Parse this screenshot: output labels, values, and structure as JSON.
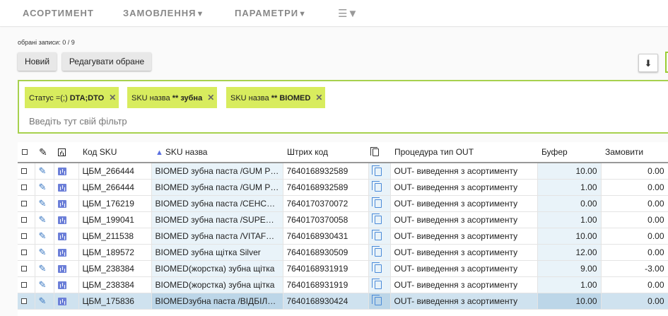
{
  "nav": {
    "items": [
      {
        "label": "АСОРТИМЕНТ",
        "caret": ""
      },
      {
        "label": "ЗАМОВЛЕННЯ",
        "caret": "▼"
      },
      {
        "label": "ПАРАМЕТРИ",
        "caret": "▼"
      }
    ],
    "menu_icon": "☰▼"
  },
  "toolbar": {
    "selected_count": "обрані записи: 0 / 9",
    "new_label": "Новий",
    "edit_label": "Редагувати обране",
    "download_icon": "download-icon"
  },
  "filters": {
    "chips": [
      {
        "field": "Статус",
        "op": "=(;)",
        "value": "DTA;DTO"
      },
      {
        "field": "SKU назва",
        "op": "**",
        "value": "зубна"
      },
      {
        "field": "SKU назва",
        "op": "**",
        "value": "BIOMED"
      }
    ],
    "placeholder": "Введіть тут свій фільтр",
    "accent_color": "#a7d14e",
    "chip_color": "#d8ec5e"
  },
  "table": {
    "headers": {
      "sku_code": "Код SKU",
      "sku_name": "SKU назва",
      "barcode": "Штрих код",
      "procedure": "Процедура тип OUT",
      "buffer": "Буфер",
      "order": "Замовити"
    },
    "sort_indicator": "▲",
    "rows": [
      {
        "code": "ЦБМ_266444",
        "name": "BIOMED зубна паста /GUM PROTECTION",
        "barcode": "7640168932589",
        "procedure": "OUT- виведення з асортименту",
        "buffer": "10.00",
        "order": "0.00"
      },
      {
        "code": "ЦБМ_266444",
        "name": "BIOMED зубна паста /GUM PROTECTION",
        "barcode": "7640168932589",
        "procedure": "OUT- виведення з асортименту",
        "buffer": "1.00",
        "order": "0.00"
      },
      {
        "code": "ЦБМ_176219",
        "name": "BIOMED зубна паста /СЕНСИТИВ",
        "barcode": "7640170370072",
        "procedure": "OUT- виведення з асортименту",
        "buffer": "0.00",
        "order": "0.00"
      },
      {
        "code": "ЦБМ_199041",
        "name": "BIOMED зубна паста /SUPERWHITE",
        "barcode": "7640170370058",
        "procedure": "OUT- виведення з асортименту",
        "buffer": "1.00",
        "order": "0.00"
      },
      {
        "code": "ЦБМ_211538",
        "name": "BIOMED зубна паста /VITAFRESH",
        "barcode": "7640168930431",
        "procedure": "OUT- виведення з асортименту",
        "buffer": "10.00",
        "order": "0.00"
      },
      {
        "code": "ЦБМ_189572",
        "name": "BIOMED зубна щітка Silver",
        "barcode": "7640168930509",
        "procedure": "OUT- виведення з асортименту",
        "buffer": "12.00",
        "order": "0.00"
      },
      {
        "code": "ЦБМ_238384",
        "name": "BIOMED(жорстка) зубна щітка",
        "barcode": "7640168931919",
        "procedure": "OUT- виведення з асортименту",
        "buffer": "9.00",
        "order": "-3.00"
      },
      {
        "code": "ЦБМ_238384",
        "name": "BIOMED(жорстка) зубна щітка",
        "barcode": "7640168931919",
        "procedure": "OUT- виведення з асортименту",
        "buffer": "1.00",
        "order": "0.00"
      },
      {
        "code": "ЦБМ_175836",
        "name": "BIOMEDзубна паста /ВІДБІЛЮВАННЯ",
        "barcode": "7640168930424",
        "procedure": "OUT- виведення з асортименту",
        "buffer": "10.00",
        "order": "0.00"
      }
    ],
    "selected_row_index": 8
  }
}
